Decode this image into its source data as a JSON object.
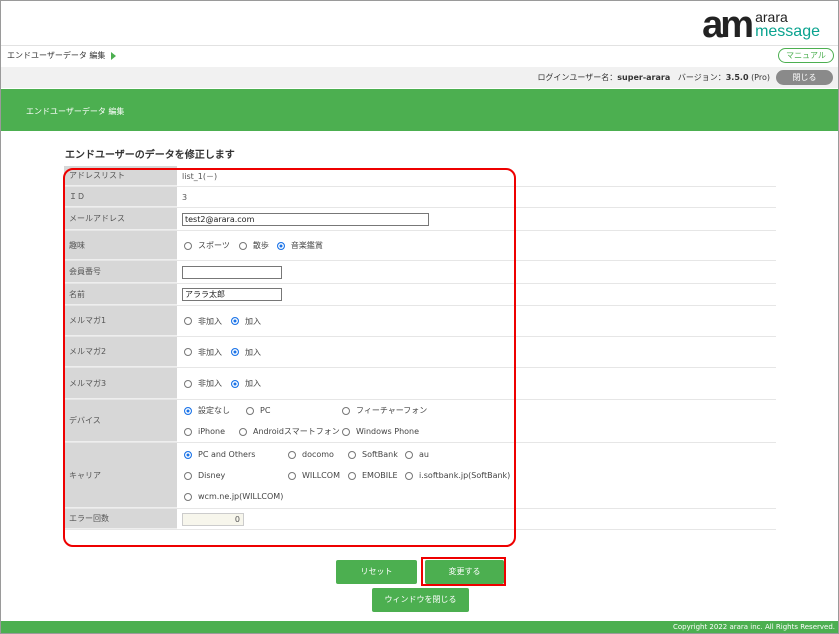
{
  "logo": {
    "mark": "am",
    "line1": "arara",
    "line2": "message"
  },
  "breadcrumb": {
    "label": "エンドユーザーデータ 編集"
  },
  "header": {
    "manual_label": "マニュアル",
    "login_prefix": "ログインユーザー名：",
    "login_user": "super-arara",
    "version_prefix": "バージョン：",
    "version": "3.5.0",
    "edition": "(Pro)",
    "close_label": "閉じる"
  },
  "page_title": "エンドユーザーデータ 編集",
  "section_title": "エンドユーザーのデータを修正します",
  "form": {
    "address_list": {
      "label": "アドレスリスト",
      "value": "list_1(－)"
    },
    "id": {
      "label": "ＩＤ",
      "value": "3"
    },
    "email": {
      "label": "メールアドレス",
      "value": "test2@arara.com"
    },
    "hobby": {
      "label": "趣味",
      "options": [
        "スポーツ",
        "散歩",
        "音楽鑑賞"
      ],
      "selected": "音楽鑑賞"
    },
    "member_no": {
      "label": "会員番号",
      "value": ""
    },
    "name": {
      "label": "名前",
      "value": "アララ太郎"
    },
    "mag1": {
      "label": "メルマガ1",
      "options": [
        "非加入",
        "加入"
      ],
      "selected": "加入"
    },
    "mag2": {
      "label": "メルマガ2",
      "options": [
        "非加入",
        "加入"
      ],
      "selected": "加入"
    },
    "mag3": {
      "label": "メルマガ3",
      "options": [
        "非加入",
        "加入"
      ],
      "selected": "加入"
    },
    "device": {
      "label": "デバイス",
      "options": [
        "設定なし",
        "PC",
        "フィーチャーフォン",
        "iPhone",
        "Androidスマートフォン",
        "Windows Phone"
      ],
      "selected": "設定なし"
    },
    "carrier": {
      "label": "キャリア",
      "options": [
        "PC and Others",
        "docomo",
        "SoftBank",
        "au",
        "Disney",
        "WILLCOM",
        "EMOBILE",
        "i.softbank.jp(SoftBank)",
        "wcm.ne.jp(WILLCOM)"
      ],
      "selected": "PC and Others"
    },
    "error_count": {
      "label": "エラー回数",
      "value": "0"
    }
  },
  "buttons": {
    "reset": "リセット",
    "change": "変更する",
    "close_window": "ウィンドウを閉じる"
  },
  "footer": {
    "copyright": "Copyright 2022 arara inc. All Rights Reserved."
  },
  "colors": {
    "accent": "#4caf50",
    "highlight": "#ee0000",
    "radio": "#1a73e8"
  }
}
